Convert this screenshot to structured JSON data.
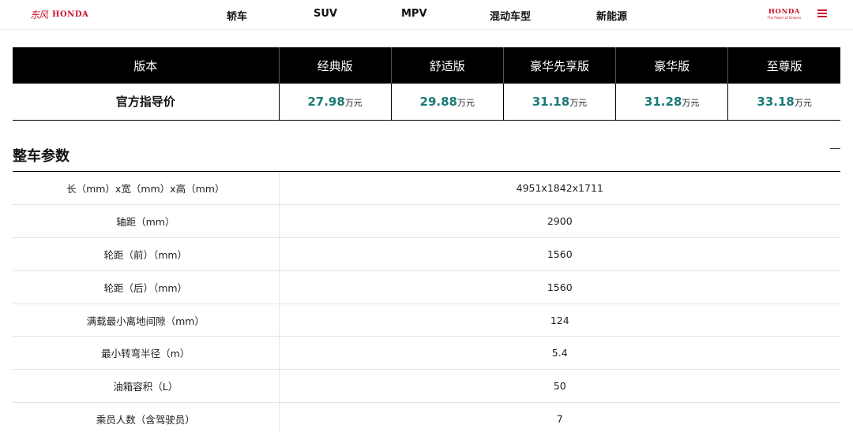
{
  "nav": {
    "brand_left_cn": "东风",
    "brand_left_en": "HONDA",
    "items": [
      "轿车",
      "SUV",
      "MPV",
      "混动车型",
      "新能源"
    ],
    "brand_right": "HONDA",
    "brand_right_tagline": "The Power of Dreams",
    "accent_color": "#c8102e"
  },
  "versions": {
    "header_label": "版本",
    "names": [
      "经典版",
      "舒适版",
      "豪华先享版",
      "豪华版",
      "至尊版"
    ],
    "price_label": "官方指导价",
    "prices": [
      "27.98",
      "29.88",
      "31.18",
      "31.28",
      "33.18"
    ],
    "price_unit": "万元",
    "price_color": "#1a7a75"
  },
  "section": {
    "title": "整车参数"
  },
  "specs": [
    {
      "label": "长（mm）x宽（mm）x高（mm）",
      "value": "4951x1842x1711"
    },
    {
      "label": "轴距（mm）",
      "value": "2900"
    },
    {
      "label": "轮距（前）（mm）",
      "value": "1560"
    },
    {
      "label": "轮距（后）（mm）",
      "value": "1560"
    },
    {
      "label": "满载最小离地间隙（mm）",
      "value": "124"
    },
    {
      "label": "最小转弯半径（m）",
      "value": "5.4"
    },
    {
      "label": "油箱容积（L）",
      "value": "50"
    },
    {
      "label": "乘员人数（含驾驶员）",
      "value": "7"
    }
  ]
}
